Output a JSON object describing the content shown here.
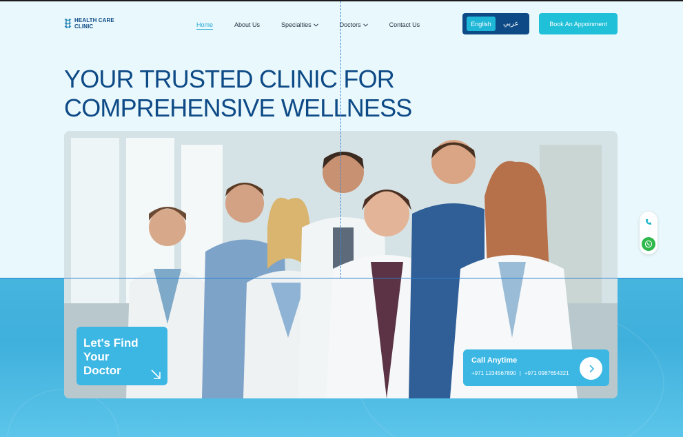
{
  "brand": {
    "line1": "HEALTH CARE",
    "line2": "CLINIC"
  },
  "nav": {
    "items": [
      {
        "label": "Home",
        "active": true
      },
      {
        "label": "About Us"
      },
      {
        "label": "Specialties",
        "dropdown": true
      },
      {
        "label": "Doctors",
        "dropdown": true
      },
      {
        "label": "Contact Us"
      }
    ]
  },
  "language": {
    "english": "English",
    "arabic": "عربي"
  },
  "book_button": "Book An Appoinment",
  "hero": {
    "title_line1": "YOUR TRUSTED CLINIC FOR",
    "title_line2": "COMPREHENSIVE WELLNESS"
  },
  "find_doctor": {
    "line1": "Let's Find",
    "line2": "Your",
    "line3": "Doctor"
  },
  "call": {
    "title": "Call Anytime",
    "phone1": "+971 1234567890",
    "separator": "|",
    "phone2": "+971 0987654321"
  },
  "colors": {
    "navy": "#0d4a86",
    "accent": "#20c0d8",
    "card": "#3cb7e4",
    "whatsapp": "#2fb84c"
  },
  "icons": [
    "logo-icon",
    "chevron-down-icon",
    "arrow-down-right-icon",
    "chevron-right-icon",
    "phone-icon",
    "whatsapp-icon"
  ]
}
